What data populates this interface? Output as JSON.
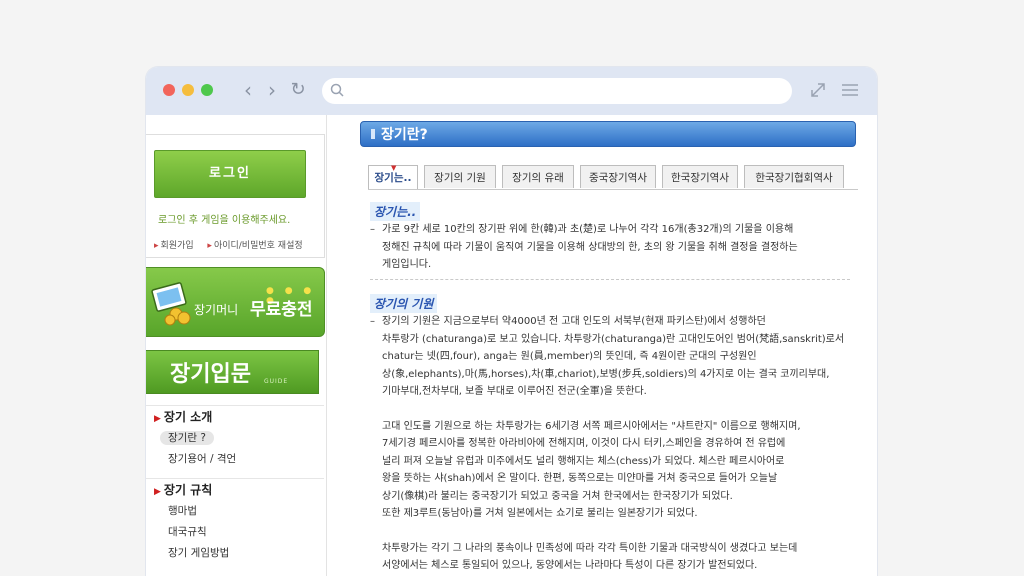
{
  "browser": {
    "back_glyph": "‹",
    "forward_glyph": "›",
    "reload_glyph": "↻",
    "url": "",
    "url_placeholder": ""
  },
  "sidebar": {
    "login_button": "로그인",
    "login_note": "로그인 후 게임을 이용해주세요.",
    "links": [
      "회원가입",
      "아이디/비밀번호 재설정"
    ],
    "charge_banner": {
      "prefix": "장기머니",
      "main": "무료충전"
    },
    "guide_banner": {
      "title": "장기입문",
      "sub": "GUIDE"
    },
    "menu": [
      {
        "section": "장기 소개",
        "items": [
          "장기란 ?",
          "장기용어 / 격언"
        ]
      },
      {
        "section": "장기 규칙",
        "items": [
          "행마법",
          "대국규칙",
          "장기 게임방법"
        ]
      }
    ]
  },
  "content": {
    "title": "장기란?",
    "tabs": [
      "장기는..",
      "장기의 기원",
      "장기의 유래",
      "중국장기역사",
      "한국장기역사",
      "한국장기협회역사"
    ],
    "sections": [
      {
        "heading": "장기는..",
        "lines": [
          "가로 9칸 세로 10칸의 장기판 위에 한(韓)과 초(楚)로 나누어 각각 16개(총32개)의 기물을 이용해",
          "정해진 규칙에 따라 기물이 움직여 기물을 이용해 상대방의 한, 초의 왕 기물을 취해 결정을 결정하는",
          "게임입니다."
        ]
      },
      {
        "heading": "장기의 기원",
        "lines": [
          "장기의 기원은 지금으로부터 약4000년 전 고대 인도의 서북부(현재 파키스탄)에서 성행하던",
          "차투랑가 (chaturanga)로 보고 있습니다. 차투랑가(chaturanga)란 고대인도어인 범어(梵語,sanskrit)로서",
          "chatur는 넷(四,four), anga는 원(員,member)의 뜻인데, 즉 4원이란 군대의 구성원인",
          "상(象,elephants),마(馬,horses),차(車,chariot),보병(步兵,soldiers)의 4가지로 이는 결국 코끼리부대,",
          "기마부대,전차부대, 보졸 부대로 이루어진 전군(全軍)을 뜻한다."
        ],
        "para2": [
          "고대 인도를 기원으로 하는 차투랑가는 6세기경 서쪽 페르시아에서는 \"샤트란지\" 이름으로 행해지며,",
          "7세기경 페르시아를 정복한 아라비아에 전해지며, 이것이 다시 터키,스페인을 경유하여 전 유럽에",
          "널리 퍼져 오늘날 유럽과 미주에서도 널리 행해지는 체스(chess)가 되었다. 체스란 페르시아어로",
          "왕을 뜻하는 샤(shah)에서 온 말이다. 한편, 동쪽으로는 미얀마를 거쳐 중국으로 들어가 오늘날",
          "상기(像棋)라 불리는 중국장기가 되었고 중국을 거쳐 한국에서는 한국장기가 되었다.",
          "또한 제3루트(동남아)를 거쳐 일본에서는 쇼기로 불리는 일본장기가 되었다."
        ],
        "para3": [
          "차투랑가는 각기 그 나라의 풍속이나 민족성에 따라 각각 특이한 기물과 대국방식이 생겼다고 보는데",
          "서양에서는 체스로 통일되어 있으나, 동양에서는 나라마다 특성이 다른 장기가 발전되었다."
        ]
      }
    ]
  }
}
